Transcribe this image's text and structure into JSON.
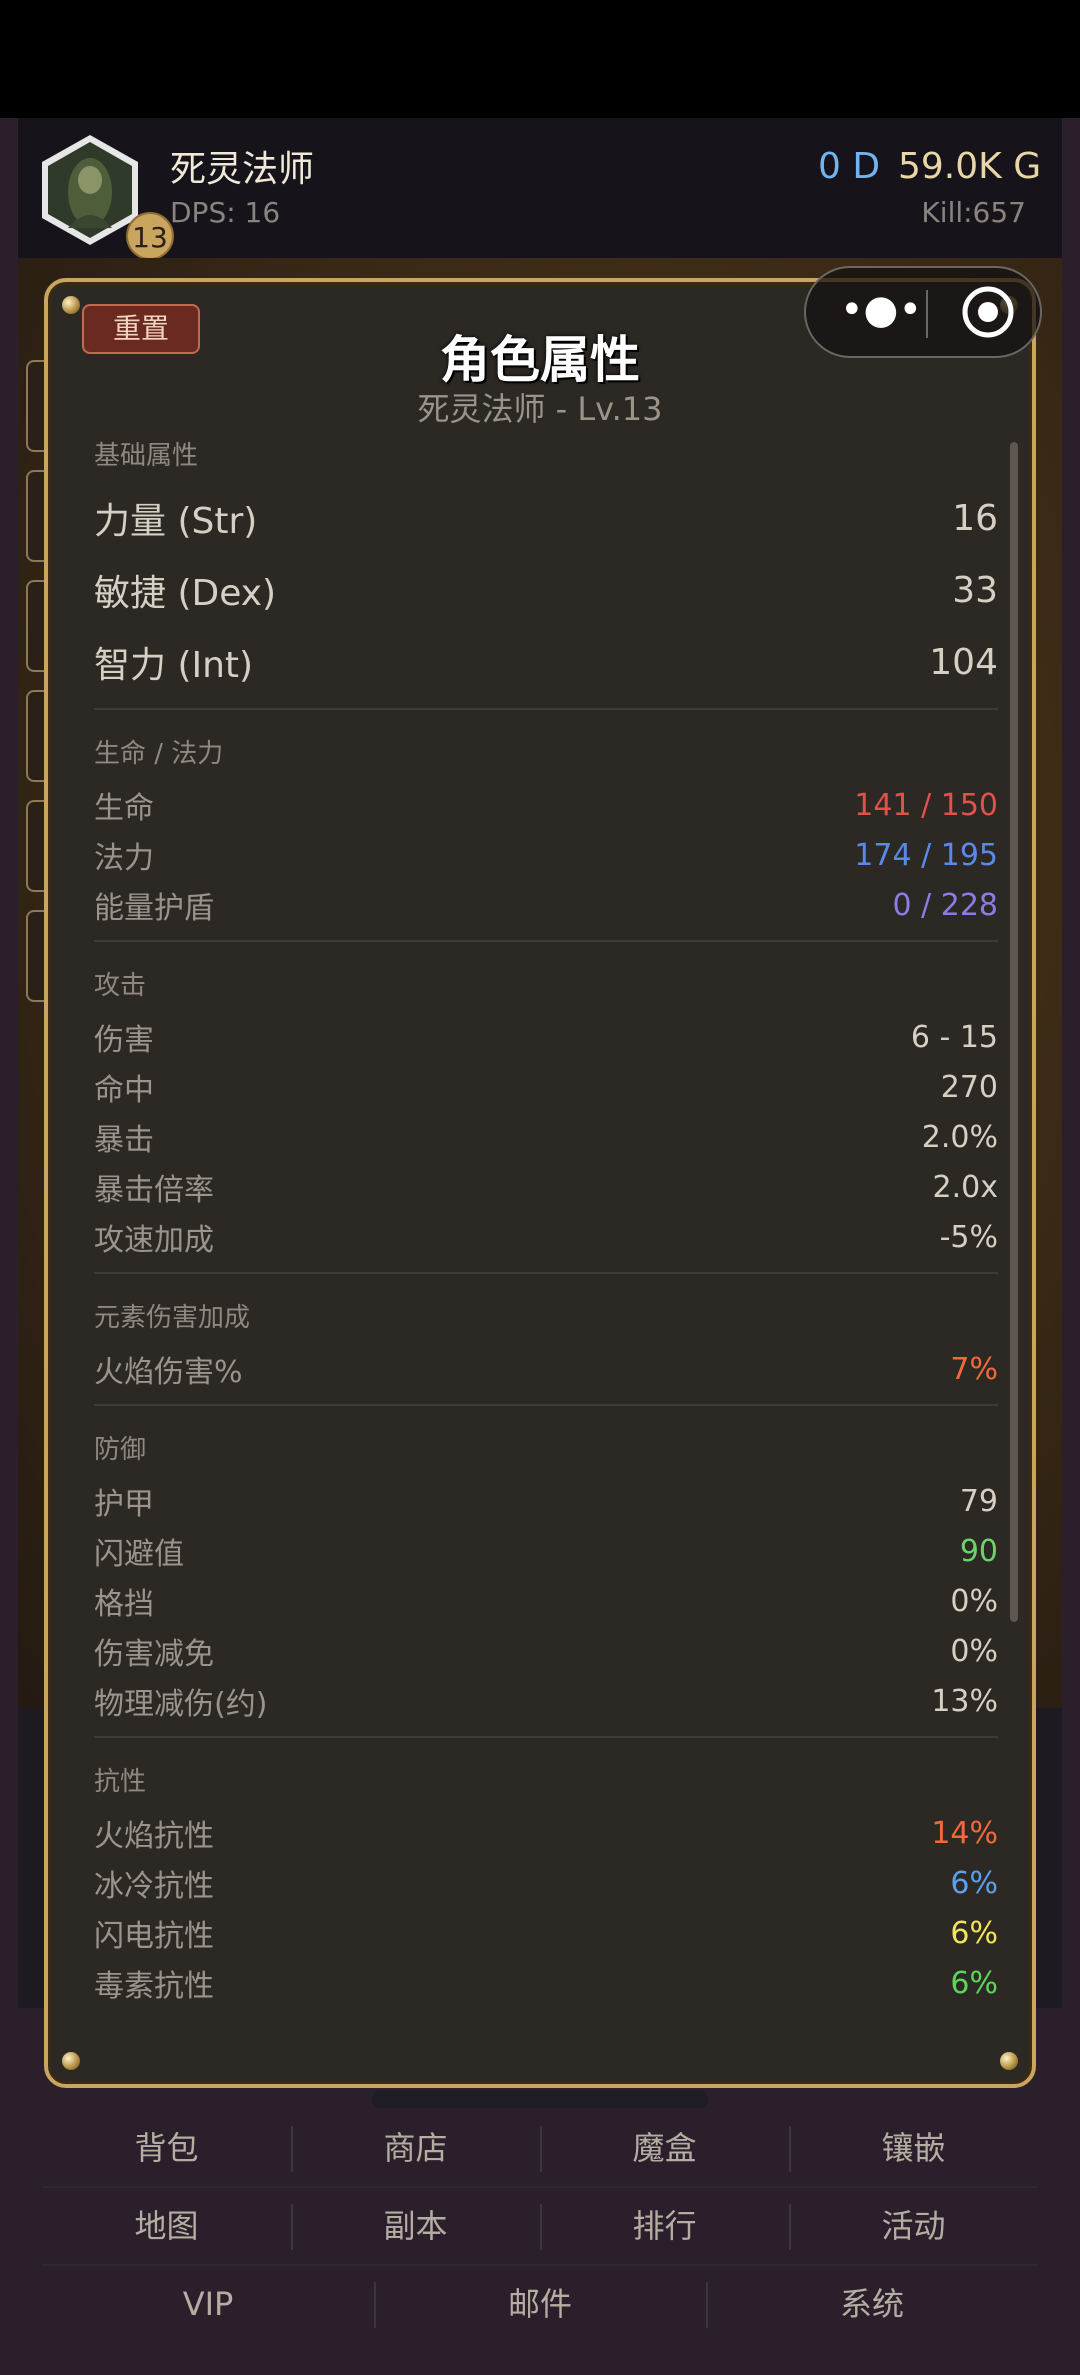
{
  "header": {
    "character_name": "死灵法师",
    "level": "13",
    "dps": "DPS: 16",
    "currency_d": "0 D",
    "currency_g": "59.0K G",
    "kill": "Kill:657"
  },
  "panel": {
    "reset_label": "重置",
    "title": "角色属性",
    "subtitle": "死灵法师 - Lv.13"
  },
  "sections": {
    "base": {
      "title": "基础属性",
      "rows": [
        {
          "label": "力量 (Str)",
          "value": "16"
        },
        {
          "label": "敏捷 (Dex)",
          "value": "33"
        },
        {
          "label": "智力 (Int)",
          "value": "104"
        }
      ]
    },
    "life": {
      "title": "生命 / 法力",
      "rows": [
        {
          "label": "生命",
          "value": "141 / 150",
          "color": "#e0524a"
        },
        {
          "label": "法力",
          "value": "174 / 195",
          "color": "#5a8ae8"
        },
        {
          "label": "能量护盾",
          "value": "0 / 228",
          "color": "#8f7ae6"
        }
      ]
    },
    "attack": {
      "title": "攻击",
      "rows": [
        {
          "label": "伤害",
          "value": "6 - 15"
        },
        {
          "label": "命中",
          "value": "270"
        },
        {
          "label": "暴击",
          "value": "2.0%"
        },
        {
          "label": "暴击倍率",
          "value": "2.0x"
        },
        {
          "label": "攻速加成",
          "value": "-5%"
        }
      ]
    },
    "elemental": {
      "title": "元素伤害加成",
      "rows": [
        {
          "label": "火焰伤害%",
          "value": "7%",
          "color": "#f06a3a"
        }
      ]
    },
    "defense": {
      "title": "防御",
      "rows": [
        {
          "label": "护甲",
          "value": "79"
        },
        {
          "label": "闪避值",
          "value": "90",
          "color": "#6ad46a"
        },
        {
          "label": "格挡",
          "value": "0%"
        },
        {
          "label": "伤害减免",
          "value": "0%"
        },
        {
          "label": "物理减伤(约)",
          "value": "13%"
        }
      ]
    },
    "resist": {
      "title": "抗性",
      "rows": [
        {
          "label": "火焰抗性",
          "value": "14%",
          "color": "#f06a3a"
        },
        {
          "label": "冰冷抗性",
          "value": "6%",
          "color": "#5aa0ec"
        },
        {
          "label": "闪电抗性",
          "value": "6%",
          "color": "#f2e456"
        },
        {
          "label": "毒素抗性",
          "value": "6%",
          "color": "#5ad65a"
        }
      ]
    }
  },
  "nav": {
    "row1": [
      "背包",
      "商店",
      "魔盒",
      "镶嵌"
    ],
    "row2": [
      "地图",
      "副本",
      "排行",
      "活动"
    ],
    "row3": [
      "VIP",
      "邮件",
      "系统"
    ]
  },
  "icons": {
    "avatar": "necromancer-portrait-icon",
    "capsule_more": "more-dots-icon",
    "capsule_close": "close-target-icon"
  }
}
